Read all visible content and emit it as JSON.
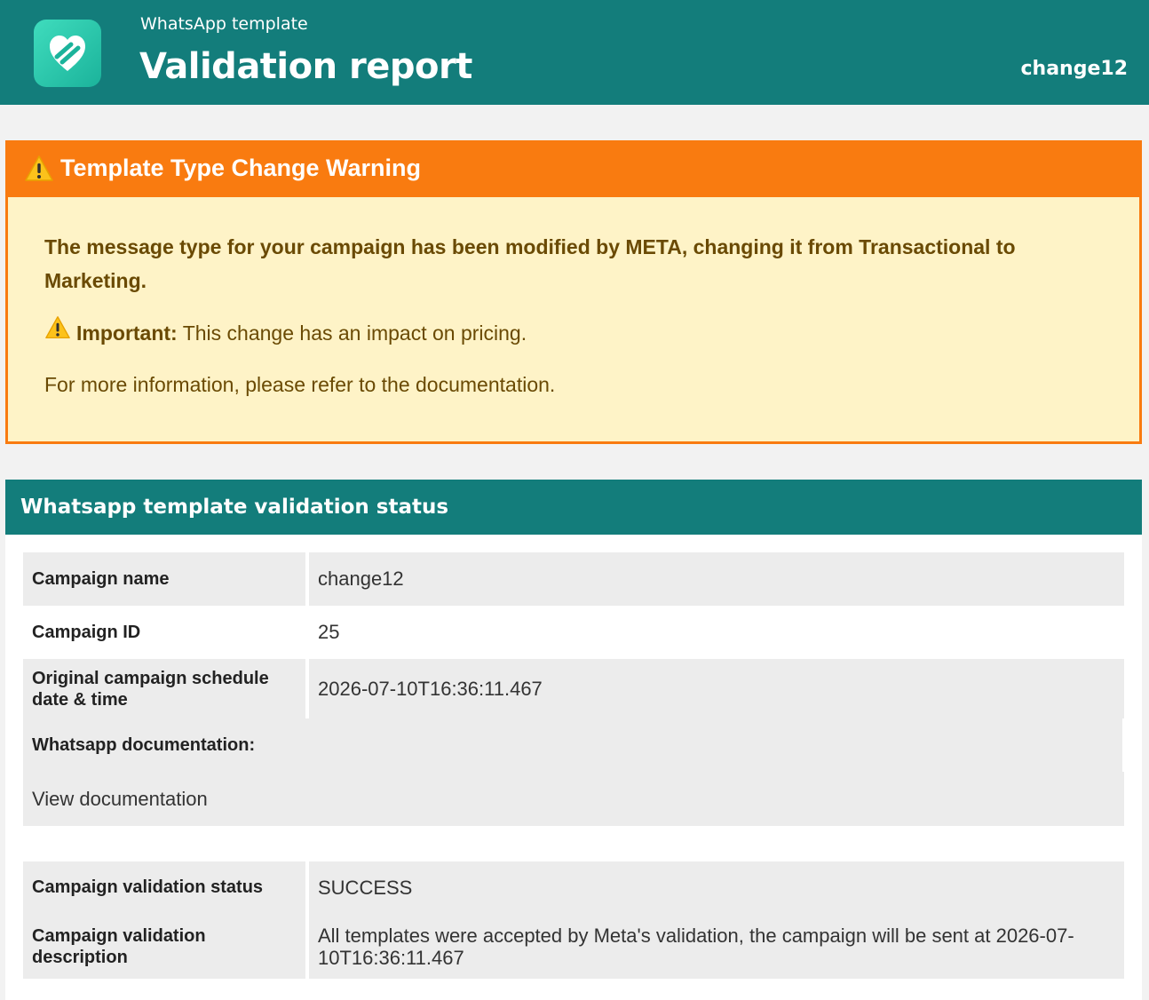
{
  "header": {
    "subtitle": "WhatsApp template",
    "title": "Validation report",
    "campaign_tag": "change12"
  },
  "warning": {
    "title": "Template Type Change Warning",
    "message": "The message type for your campaign has been modified by META, changing it from Transactional to Marketing.",
    "important_label": "Important:",
    "important_text": "This change has an impact on pricing.",
    "info": "For more information, please refer to the documentation."
  },
  "status_section": {
    "title": "Whatsapp template validation status",
    "rows": [
      {
        "label": "Campaign name",
        "value": "change12"
      },
      {
        "label": "Campaign ID",
        "value": "25"
      },
      {
        "label": "Original campaign schedule date & time",
        "value": "2026-07-10T16:36:11.467"
      }
    ],
    "documentation_label": "Whatsapp documentation:",
    "documentation_link": "View documentation",
    "validation": {
      "status_label": "Campaign validation status",
      "status_value": "SUCCESS",
      "description_label": "Campaign validation description",
      "description_value": "All templates were accepted by Meta's validation, the campaign will be sent at 2026-07-10T16:36:11.467"
    }
  },
  "colors": {
    "header_bg": "#137d7b",
    "warning_orange": "#f97b10",
    "warning_bg": "#fef3c7",
    "warning_text": "#6a4a04",
    "row_gray": "#ececec"
  },
  "icons": [
    "app-logo-icon",
    "warning-icon"
  ]
}
